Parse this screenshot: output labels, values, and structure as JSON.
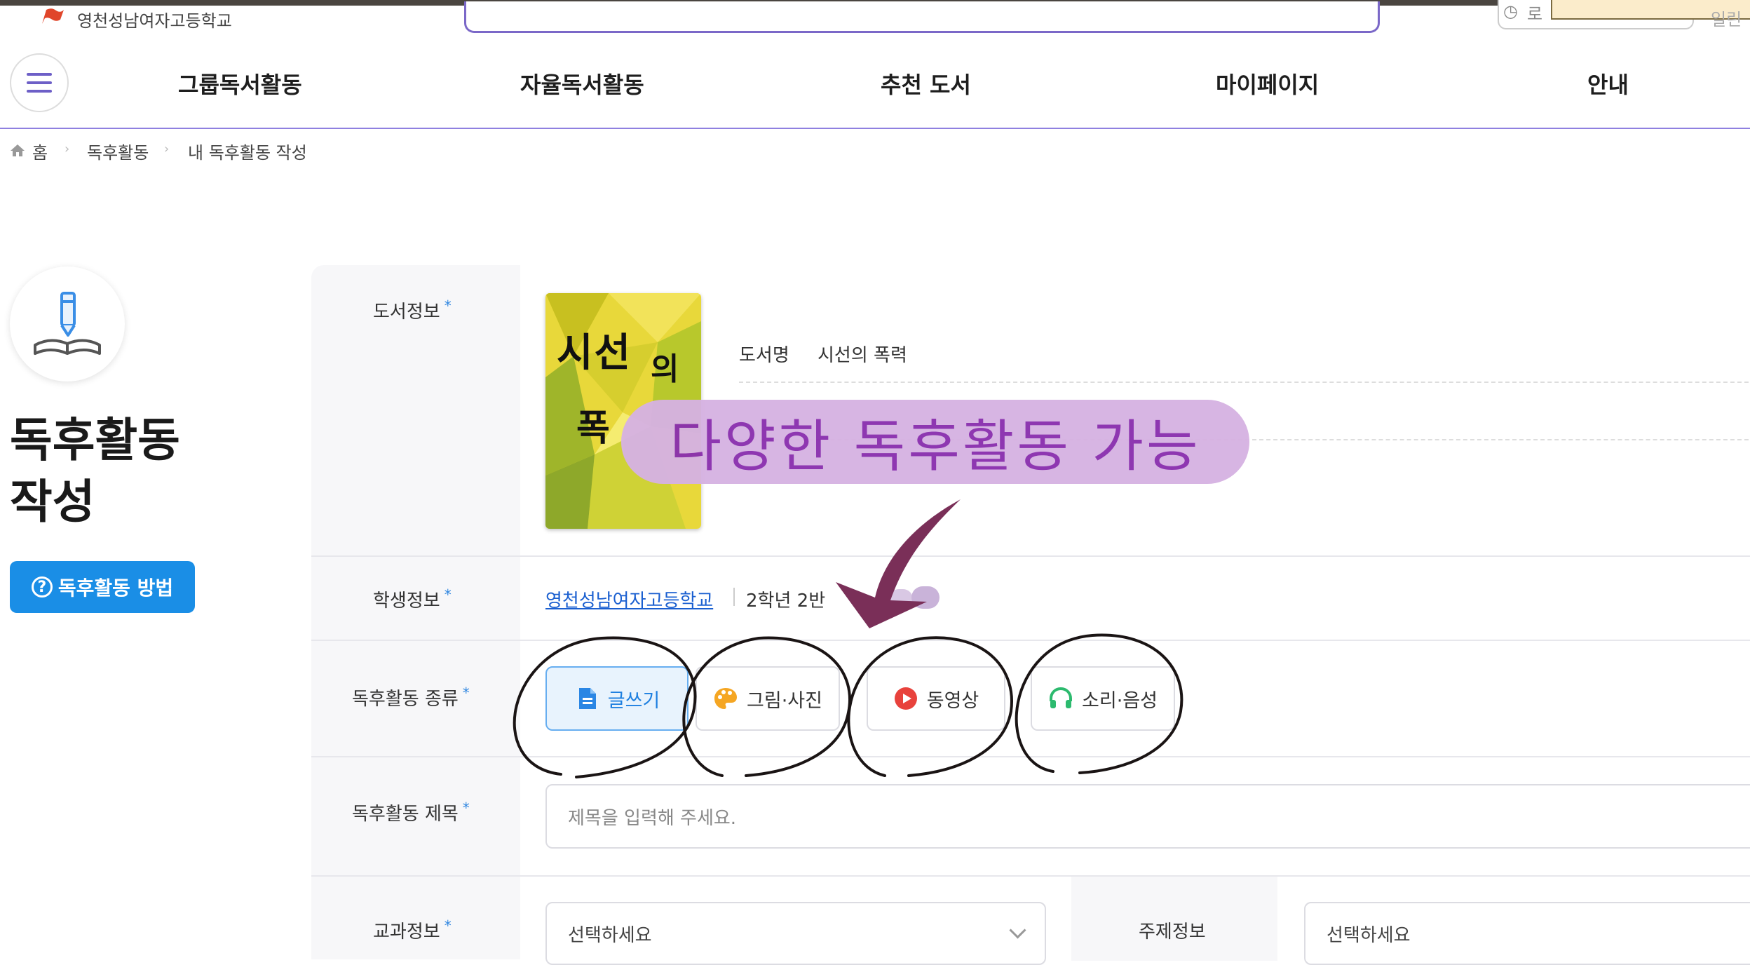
{
  "header": {
    "school_name": "영천성남여자고등학교",
    "top_right_partial": "로",
    "top_far_partial": "일린"
  },
  "nav": {
    "items": [
      {
        "label": "그룹독서활동"
      },
      {
        "label": "자율독서활동"
      },
      {
        "label": "추천 도서"
      },
      {
        "label": "마이페이지"
      },
      {
        "label": "안내"
      }
    ]
  },
  "breadcrumb": {
    "home": "홈",
    "level1": "독후활동",
    "level2": "내 독후활동 작성"
  },
  "sidebar": {
    "title_line1": "독후활동",
    "title_line2": "작성",
    "how_button": "독후활동 방법"
  },
  "form": {
    "book_info": {
      "label": "도서정보",
      "required_mark": "*",
      "cover_text_1": "시선",
      "cover_text_2": "의",
      "cover_text_3": "폭",
      "book_name_label": "도서명",
      "book_name": "시선의 폭력"
    },
    "student_info": {
      "label": "학생정보",
      "required_mark": "*",
      "school": "영천성남여자고등학교",
      "grade_class": "2학년 2반"
    },
    "activity_type": {
      "label": "독후활동 종류",
      "required_mark": "*",
      "options": [
        {
          "label": "글쓰기",
          "icon": "document-icon",
          "selected": true
        },
        {
          "label": "그림·사진",
          "icon": "palette-icon",
          "selected": false
        },
        {
          "label": "동영상",
          "icon": "play-icon",
          "selected": false
        },
        {
          "label": "소리·음성",
          "icon": "headphones-icon",
          "selected": false
        }
      ]
    },
    "activity_title": {
      "label": "독후활동 제목",
      "required_mark": "*",
      "placeholder": "제목을 입력해 주세요."
    },
    "subject_info": {
      "label": "교과정보",
      "required_mark": "*",
      "selected": "선택하세요"
    },
    "topic_info": {
      "label": "주제정보",
      "selected": "선택하세요"
    }
  },
  "annotation": {
    "bubble_text": "다양한 독후활동 가능"
  },
  "colors": {
    "accent": "#1a8ee6",
    "nav_line": "#8f80e0",
    "active_btn_bg": "#e8f3fd",
    "bubble": "#d6b2e2",
    "bubble_text": "#8a2fae",
    "arrow": "#7a2f58"
  }
}
